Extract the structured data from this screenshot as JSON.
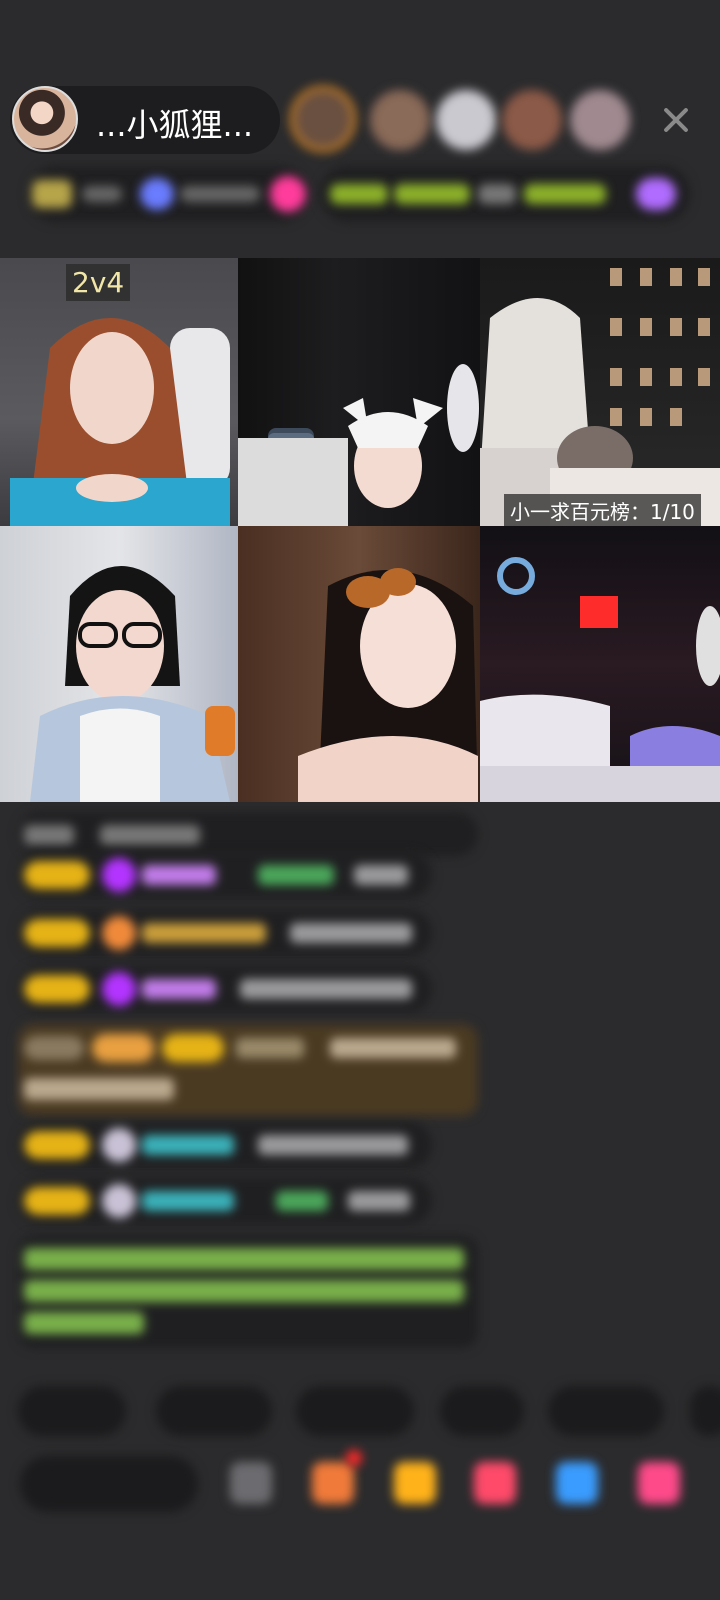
{
  "header": {
    "host_name": "...小狐狸...",
    "host_avatar": "streamer-avatar",
    "close_icon": "close-icon"
  },
  "video_grid": {
    "tiles": [
      {
        "label": "2v4"
      },
      {
        "label": ""
      },
      {
        "label": "小一求百元榜：1/10"
      },
      {
        "label": ""
      },
      {
        "label": ""
      },
      {
        "label": ""
      }
    ]
  },
  "colors": {
    "background": "#2b2b2d",
    "level_badge": "#e6b316",
    "system_message_text": "#79b04a",
    "highlight_message_bg": "#4a3a22"
  }
}
